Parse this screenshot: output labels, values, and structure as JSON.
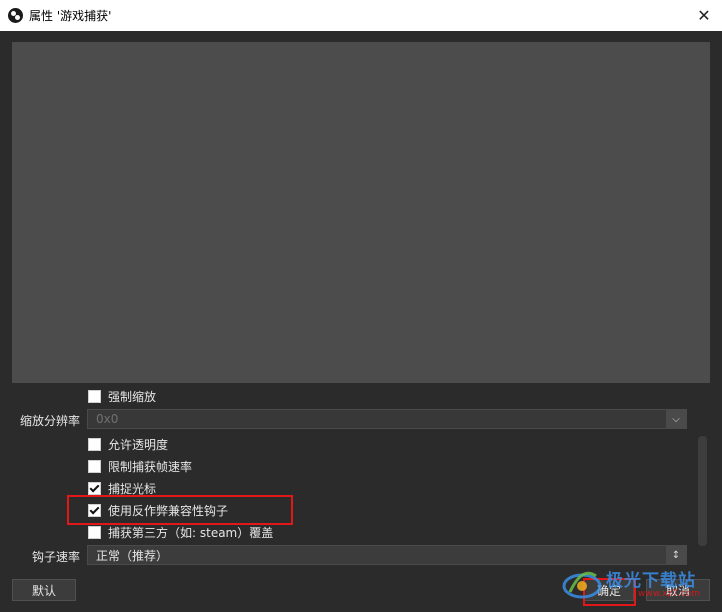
{
  "window": {
    "title": "属性 '游戏捕获'"
  },
  "options": {
    "force_scale": {
      "label": "强制缩放",
      "checked": false
    },
    "scale_resolution": {
      "label": "缩放分辨率",
      "value": "0x0"
    },
    "allow_transparency": {
      "label": "允许透明度",
      "checked": false
    },
    "limit_fps": {
      "label": "限制捕获帧速率",
      "checked": false
    },
    "capture_cursor": {
      "label": "捕捉光标",
      "checked": true
    },
    "anticheat_hook": {
      "label": "使用反作弊兼容性钩子",
      "checked": true
    },
    "third_party_overlay": {
      "label": "捕获第三方（如: steam）覆盖",
      "checked": false
    },
    "hook_rate": {
      "label": "钩子速率",
      "value": "正常（推荐）"
    }
  },
  "buttons": {
    "defaults": "默认",
    "ok": "确定",
    "cancel": "取消"
  },
  "watermark": {
    "text": "极光下载站",
    "url": "www.xz7.com"
  },
  "colors": {
    "highlight": "#e01818",
    "background": "#2b2b2b",
    "preview": "#4c4c4c"
  }
}
